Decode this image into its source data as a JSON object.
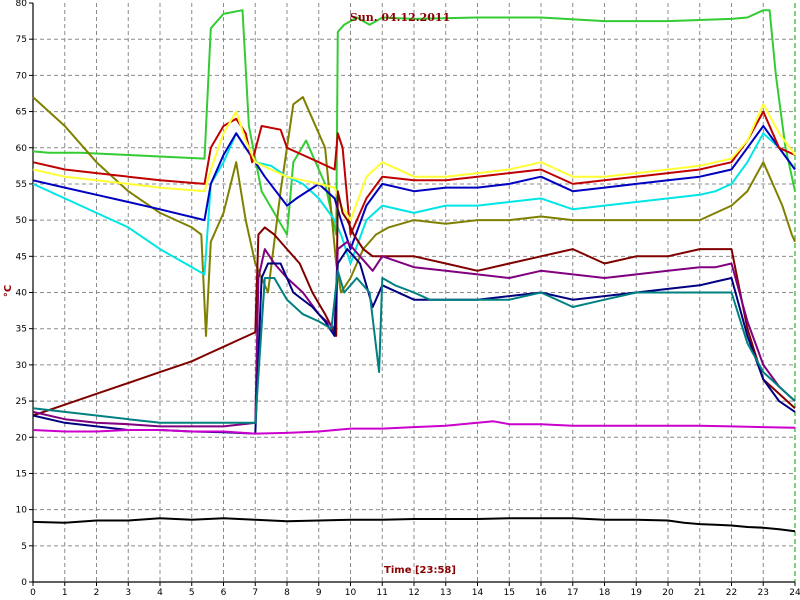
{
  "chart_data": {
    "type": "line",
    "title": "Sun. 04.12.2011",
    "xlabel": "Time [23:58]",
    "ylabel": "°C",
    "xlim": [
      0,
      24
    ],
    "ylim": [
      0,
      80
    ],
    "x_ticks": [
      "0",
      "1",
      "2",
      "3",
      "4",
      "5",
      "6",
      "7",
      "8",
      "9",
      "10",
      "11",
      "12",
      "13",
      "14",
      "15",
      "16",
      "17",
      "18",
      "19",
      "20",
      "21",
      "22",
      "23",
      "24"
    ],
    "y_ticks": [
      "0",
      "5",
      "10",
      "15",
      "20",
      "25",
      "30",
      "35",
      "40",
      "45",
      "50",
      "55",
      "60",
      "65",
      "70",
      "75",
      "80"
    ],
    "grid": true,
    "series": [
      {
        "color": "#33cc33",
        "x": [
          0,
          0.5,
          1.5,
          3,
          5.4,
          5.6,
          6.0,
          6.6,
          6.8,
          7.2,
          8.0,
          8.2,
          8.6,
          9.2,
          9.55,
          9.6,
          9.8,
          10.2,
          10.6,
          11,
          12,
          14,
          16,
          18,
          20,
          22,
          22.5,
          23.0,
          23.2,
          23.4,
          23.7,
          24
        ],
        "y": [
          59.5,
          59.3,
          59.3,
          59.0,
          58.5,
          76.5,
          78.5,
          79,
          63,
          54,
          48,
          58,
          61,
          55,
          48,
          76,
          77,
          78,
          77,
          78,
          77.8,
          78,
          78,
          77.5,
          77.5,
          77.8,
          78,
          79,
          79,
          70,
          60,
          54
        ]
      },
      {
        "color": "#808000",
        "x": [
          0,
          1,
          2,
          3,
          4,
          5,
          5.3,
          5.45,
          5.6,
          6.0,
          6.4,
          6.7,
          7.0,
          7.4,
          7.8,
          8.2,
          8.5,
          8.8,
          9.2,
          9.55,
          9.7,
          10,
          10.4,
          10.8,
          11.2,
          12,
          13,
          14,
          15,
          16,
          17,
          18,
          19,
          20,
          21,
          21.5,
          22,
          22.5,
          23,
          23.3,
          23.6,
          23.9,
          24
        ],
        "y": [
          67,
          63,
          58,
          54,
          51,
          49,
          48,
          34,
          47,
          51,
          58,
          50,
          44,
          40,
          54,
          66,
          67,
          64,
          60,
          44,
          40,
          42,
          46,
          48,
          49,
          50,
          49.5,
          50,
          50,
          50.5,
          50,
          50,
          50,
          50,
          50,
          51,
          52,
          54,
          58,
          55,
          52,
          48,
          47
        ]
      },
      {
        "color": "#00e5e5",
        "x": [
          0,
          1,
          2,
          3,
          4,
          5.4,
          5.6,
          6.0,
          6.4,
          6.7,
          7,
          7.5,
          8,
          8.5,
          9.0,
          9.5,
          9.7,
          10,
          10.5,
          11,
          12,
          13,
          14,
          15,
          16,
          17,
          18,
          19,
          20,
          21,
          21.5,
          22,
          22.5,
          23,
          23.5,
          24
        ],
        "y": [
          55,
          53,
          51,
          49,
          46,
          42.5,
          55,
          58,
          62,
          60,
          58,
          57.5,
          56,
          55,
          53,
          50,
          48,
          44,
          50,
          52,
          51,
          52,
          52,
          52.5,
          53,
          51.5,
          52,
          52.5,
          53,
          53.5,
          54,
          55,
          58,
          62,
          60,
          57
        ]
      },
      {
        "color": "#0000c0",
        "x": [
          0,
          1,
          2,
          3,
          4,
          5.4,
          5.6,
          6.0,
          6.4,
          6.7,
          7.0,
          7.3,
          8,
          8.3,
          9.0,
          9.5,
          9.7,
          10,
          10.5,
          11,
          12,
          13,
          14,
          15,
          16,
          17,
          18,
          19,
          20,
          21,
          21.5,
          22,
          22.5,
          23,
          23.5,
          24
        ],
        "y": [
          55.5,
          54.5,
          53.5,
          52.5,
          51.5,
          50,
          55,
          59,
          62,
          60,
          58,
          56,
          52,
          53,
          55,
          53,
          50,
          46,
          52,
          55,
          54,
          54.5,
          54.5,
          55,
          56,
          54,
          54.5,
          55,
          55.5,
          56,
          56.5,
          57,
          60,
          63,
          60,
          57
        ]
      },
      {
        "color": "#c00000",
        "x": [
          0,
          1,
          2,
          3,
          4,
          5.4,
          5.6,
          6.0,
          6.4,
          6.7,
          6.9,
          7.2,
          7.8,
          8.0,
          8.5,
          9.0,
          9.5,
          9.6,
          9.75,
          10,
          10.5,
          11,
          12,
          13,
          14,
          15,
          16,
          17,
          18,
          19,
          20,
          21,
          21.5,
          22,
          22.5,
          23,
          23.5,
          24
        ],
        "y": [
          58,
          57,
          56.5,
          56,
          55.5,
          55,
          60,
          63,
          64,
          62,
          58,
          63,
          62.5,
          60,
          59,
          58,
          57,
          62,
          60,
          48,
          53,
          56,
          55.5,
          55.5,
          56,
          56.5,
          57,
          55,
          55.5,
          56,
          56.5,
          57,
          57.5,
          58,
          61,
          65,
          60,
          59
        ]
      },
      {
        "color": "#ffff33",
        "x": [
          0,
          1,
          2,
          3,
          4,
          5.4,
          5.6,
          6.0,
          6.4,
          6.7,
          7,
          7.5,
          8,
          8.5,
          9.0,
          9.5,
          9.7,
          10,
          10.5,
          11,
          12,
          13,
          14,
          15,
          16,
          17,
          18,
          19,
          20,
          21,
          21.5,
          22,
          22.5,
          23,
          23.5,
          24
        ],
        "y": [
          57,
          56,
          55.5,
          55,
          54.5,
          54,
          57,
          62,
          65,
          61,
          58,
          57,
          56,
          55.5,
          55,
          54.5,
          52,
          50,
          56,
          58,
          56,
          56,
          56.5,
          57,
          58,
          56,
          56,
          56.5,
          57,
          57.5,
          58,
          58.5,
          61,
          66,
          62,
          59
        ]
      },
      {
        "color": "#800000",
        "x": [
          0,
          1,
          2,
          3,
          4,
          5,
          5.5,
          6,
          6.5,
          7.0,
          7.1,
          7.3,
          7.6,
          8,
          8.4,
          8.8,
          9.2,
          9.55,
          9.6,
          9.75,
          9.9,
          10.1,
          10.4,
          10.7,
          11,
          12,
          13,
          14,
          15,
          16,
          17,
          18,
          19,
          20,
          21,
          21.5,
          22,
          22.5,
          23,
          23.5,
          24
        ],
        "y": [
          23,
          24.5,
          26,
          27.5,
          29,
          30.5,
          31.5,
          32.5,
          33.5,
          34.5,
          48,
          49,
          48,
          46,
          44,
          40,
          37,
          34,
          54,
          51,
          50,
          48,
          46,
          45,
          45,
          45,
          44,
          43,
          44,
          45,
          46,
          44,
          45,
          45,
          46,
          46,
          46,
          35,
          28,
          26,
          24
        ]
      },
      {
        "color": "#800080",
        "x": [
          0,
          1,
          2,
          3,
          4,
          5,
          6,
          7.0,
          7.1,
          7.3,
          7.6,
          8,
          8.5,
          9.0,
          9.5,
          9.6,
          9.9,
          10.3,
          10.7,
          11,
          12,
          13,
          14,
          15,
          16,
          17,
          18,
          19,
          20,
          21,
          21.5,
          22,
          22.5,
          23,
          23.5,
          24
        ],
        "y": [
          23.5,
          22.5,
          22,
          21.8,
          21.5,
          21.5,
          21.5,
          22,
          42,
          46,
          44,
          42,
          40,
          37,
          35,
          46,
          47,
          45,
          43,
          45,
          43.5,
          43,
          42.5,
          42,
          43,
          42.5,
          42,
          42.5,
          43,
          43.5,
          43.5,
          44,
          36,
          30,
          27,
          25
        ]
      },
      {
        "color": "#000080",
        "x": [
          0,
          1,
          2,
          3,
          4,
          5,
          6,
          7.0,
          7.2,
          7.4,
          7.8,
          8.2,
          8.8,
          9.2,
          9.5,
          9.6,
          9.9,
          10.3,
          10.7,
          11,
          12,
          13,
          14,
          15,
          16,
          17,
          18,
          19,
          20,
          21,
          21.5,
          22,
          22.5,
          23,
          23.5,
          24
        ],
        "y": [
          23,
          22,
          21.5,
          21,
          21,
          20.8,
          20.7,
          20.5,
          42,
          44,
          44,
          40,
          38,
          36,
          34,
          44,
          46,
          44,
          38,
          41,
          39,
          39,
          39,
          39.5,
          40,
          39,
          39.5,
          40,
          40.5,
          41,
          41.5,
          42,
          34,
          28,
          25,
          23.5
        ]
      },
      {
        "color": "#008080",
        "x": [
          0,
          1,
          2,
          3,
          4,
          5,
          6,
          7.0,
          7.3,
          7.6,
          8,
          8.5,
          9,
          9.4,
          9.6,
          9.8,
          10.2,
          10.6,
          10.9,
          11,
          11.4,
          12,
          12.5,
          13,
          14,
          15,
          16,
          17,
          18,
          19,
          20,
          21,
          21.5,
          22,
          22.5,
          23,
          23.5,
          24
        ],
        "y": [
          24,
          23.5,
          23,
          22.5,
          22,
          22,
          22,
          22,
          42,
          42,
          39,
          37,
          36,
          35,
          43,
          40,
          42,
          40,
          29,
          42,
          41,
          40,
          39,
          39,
          39,
          39,
          40,
          38,
          39,
          40,
          40,
          40,
          40,
          40,
          33,
          29,
          27,
          25
        ]
      },
      {
        "color": "#cc00cc",
        "x": [
          0,
          1,
          2,
          3,
          4,
          5,
          6,
          7,
          8,
          9,
          10,
          11,
          12,
          13,
          14,
          14.5,
          15,
          16,
          17,
          18,
          19,
          20,
          21,
          22,
          23,
          24
        ],
        "y": [
          21,
          20.8,
          20.8,
          21,
          21,
          20.8,
          20.8,
          20.5,
          20.6,
          20.8,
          21.2,
          21.2,
          21.4,
          21.6,
          22,
          22.2,
          21.8,
          21.8,
          21.6,
          21.6,
          21.6,
          21.6,
          21.6,
          21.5,
          21.4,
          21.3
        ]
      },
      {
        "color": "#000000",
        "x": [
          0,
          1,
          2,
          3,
          4,
          5,
          6,
          7,
          8,
          9,
          10,
          11,
          12,
          13,
          14,
          15,
          16,
          17,
          18,
          19,
          20,
          20.5,
          21,
          21.5,
          22,
          22.5,
          23,
          23.5,
          24
        ],
        "y": [
          8.3,
          8.2,
          8.5,
          8.5,
          8.8,
          8.6,
          8.8,
          8.6,
          8.4,
          8.5,
          8.6,
          8.6,
          8.7,
          8.7,
          8.7,
          8.8,
          8.8,
          8.8,
          8.6,
          8.6,
          8.5,
          8.2,
          8.0,
          7.9,
          7.8,
          7.6,
          7.5,
          7.3,
          7.0
        ]
      }
    ]
  }
}
